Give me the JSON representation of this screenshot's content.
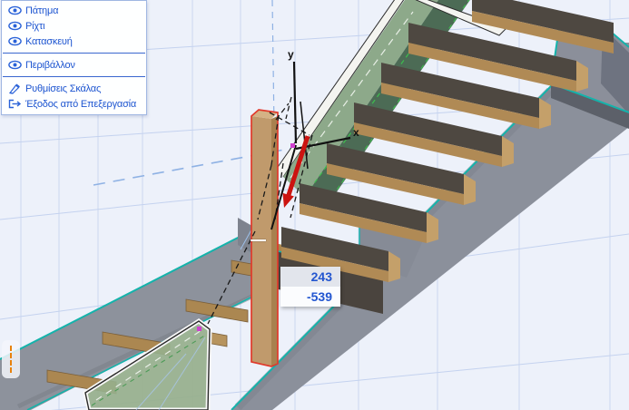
{
  "context_menu": {
    "items": [
      {
        "icon": "eye-icon",
        "label": "Πάτημα"
      },
      {
        "icon": "eye-icon",
        "label": "Ρίχτι"
      },
      {
        "icon": "eye-icon",
        "label": "Κατασκευή"
      },
      {
        "icon": "eye-icon",
        "label": "Περιβάλλον"
      },
      {
        "icon": "stair-settings-icon",
        "label": "Ρυθμίσεις Σκάλας"
      },
      {
        "icon": "exit-edit-icon",
        "label": "Έξοδος από Επεξεργασία"
      }
    ]
  },
  "tracker": {
    "x_value": "243",
    "y_value": "-539",
    "active_value": "243"
  },
  "axes": {
    "x_label": "x",
    "y_label": "y"
  },
  "colors": {
    "background": "#edf1fa",
    "grid_blue": "#ccd7f0",
    "guide_blue": "#8fb2e4",
    "menu_text": "#1c54d0",
    "selection_teal": "#14b3ab",
    "editable_green": "#3dbf4e",
    "highlight_red": "#e0392b",
    "drag_arrow_red": "#cc1410",
    "ghost_panel_green": "#96af8c",
    "stringer_green": "#8da98a",
    "stringer_gray": "#8b909b",
    "tread_wood": "#b18c57",
    "column_wood": "#c09a6c",
    "hotspot_magenta": "#d040d0",
    "tracker_text": "#2356d0",
    "handle_orange": "#e8820c"
  }
}
